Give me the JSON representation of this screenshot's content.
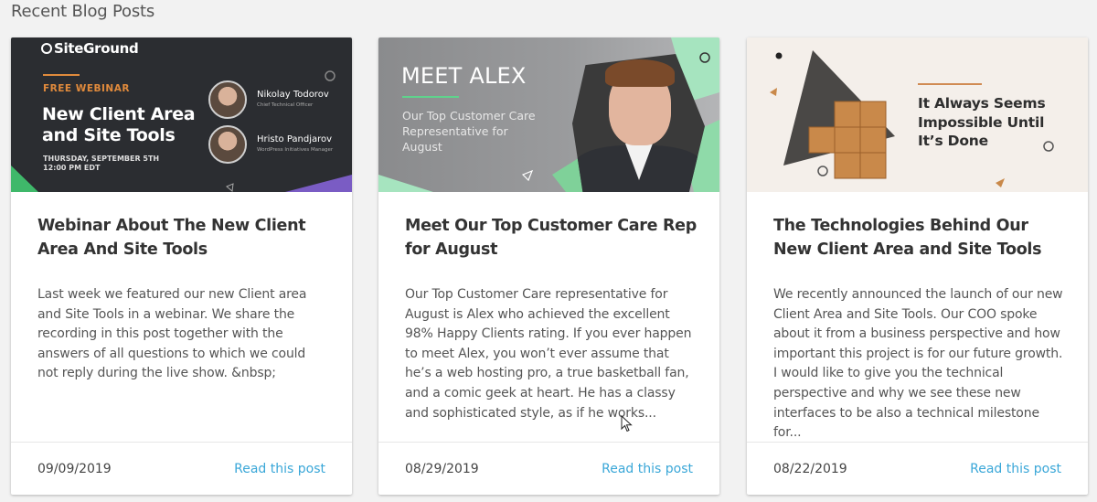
{
  "section": {
    "title": "Recent Blog Posts"
  },
  "posts": [
    {
      "title": "Webinar About The New Client Area And Site Tools",
      "excerpt": "Last week we featured our new Client area and Site Tools in a webinar. We share the recording in this post together with the answers of all questions to which we could not reply during the live show. &nbsp;",
      "date": "09/09/2019",
      "link_label": "Read this post",
      "thumbnail": {
        "logo": "SiteGround",
        "eyebrow": "FREE WEBINAR",
        "heading": "New Client Area and Site Tools",
        "date_line1": "THURSDAY, SEPTEMBER 5TH",
        "date_line2": "12:00 PM EDT",
        "speakers": [
          {
            "name": "Nikolay Todorov",
            "role": "Chief Technical Officer"
          },
          {
            "name": "Hristo Pandjarov",
            "role": "WordPress Initiatives Manager"
          }
        ]
      }
    },
    {
      "title": "Meet Our Top Customer Care Rep for August",
      "excerpt": "Our Top Customer Care representative for August is Alex who achieved the excellent 98% Happy Clients rating. If you ever happen to meet Alex, you won’t ever assume that he’s a web hosting pro, a true basketball fan, and a comic geek at heart. He has a classy and sophisticated style, as if he works...",
      "date": "08/29/2019",
      "link_label": "Read this post",
      "thumbnail": {
        "heading": "MEET ALEX",
        "subheading": "Our Top Customer Care Representative for August"
      }
    },
    {
      "title": "The Technologies Behind Our New Client Area and Site Tools",
      "excerpt": "We recently announced the launch of our new Client Area and Site Tools. Our COO spoke about it from a business perspective and how important this project is for our future growth. I would like to give you the technical perspective and why we see these new interfaces to be also a technical milestone for...",
      "date": "08/22/2019",
      "link_label": "Read this post",
      "thumbnail": {
        "heading": "It Always Seems Impossible Until It’s Done"
      }
    }
  ],
  "colors": {
    "link": "#3aa7d8",
    "accent_orange": "#e08a3c",
    "accent_green": "#5fd38c",
    "background": "#f2f2f2"
  }
}
